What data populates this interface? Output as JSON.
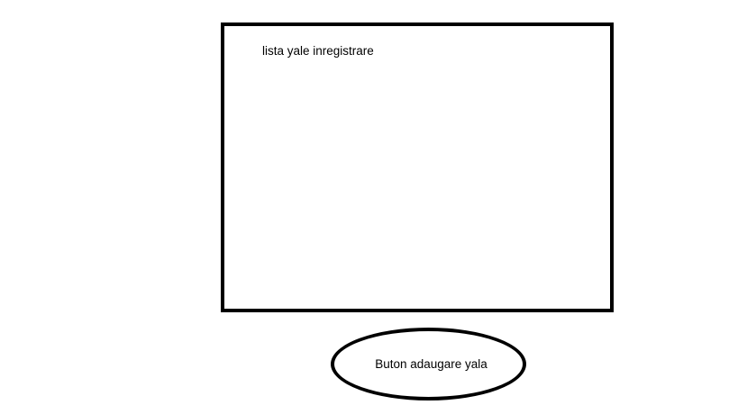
{
  "locks_list": {
    "title": "lista yale inregistrare"
  },
  "add_button": {
    "label": "Buton adaugare yala"
  }
}
